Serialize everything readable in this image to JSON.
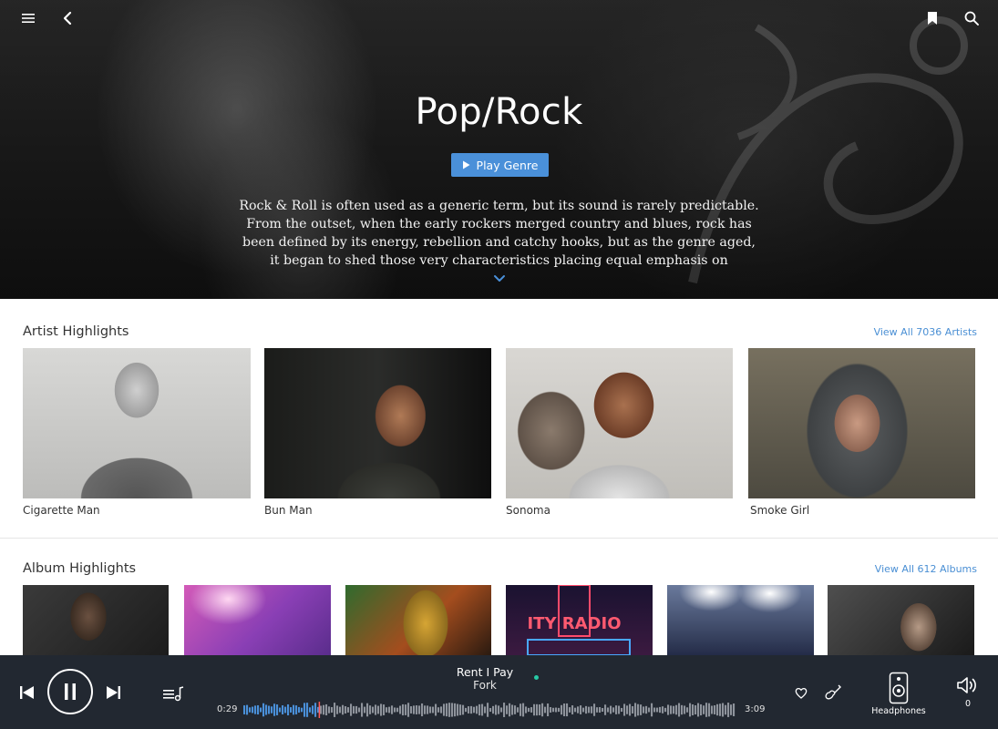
{
  "header": {
    "title": "Pop/Rock",
    "play_button_label": "Play Genre",
    "description": "Rock & Roll is often used as a generic term, but its sound is rarely predictable. From the outset, when the early rockers merged country and blues, rock has been defined by its energy, rebellion and catchy hooks, but as the genre aged, it began to shed those very characteristics placing equal emphasis on craftmanship and",
    "icons": [
      "menu-icon",
      "back-icon",
      "bookmark-icon",
      "search-icon",
      "chevron-down-icon"
    ]
  },
  "artists": {
    "section_title": "Artist Highlights",
    "view_all_label": "View All 7036 Artists",
    "items": [
      {
        "name": "Cigarette Man"
      },
      {
        "name": "Bun Man"
      },
      {
        "name": "Sonoma"
      },
      {
        "name": "Smoke Girl"
      }
    ]
  },
  "albums": {
    "section_title": "Album Highlights",
    "view_all_label": "View All 612 Albums",
    "count_visible": 6,
    "sign_text": "ITY RADIO"
  },
  "player": {
    "track_title": "Rent I Pay",
    "track_artist": "Fork",
    "elapsed": "0:29",
    "duration": "3:09",
    "progress_fraction": 0.153,
    "output_device_label": "Headphones",
    "volume_value": "0",
    "accent_color": "#4a90d9",
    "status_dot_color": "#27c9a5"
  },
  "colors": {
    "accent": "#4a90d9",
    "link": "#4a8fd4",
    "player_bg": "#222831"
  }
}
